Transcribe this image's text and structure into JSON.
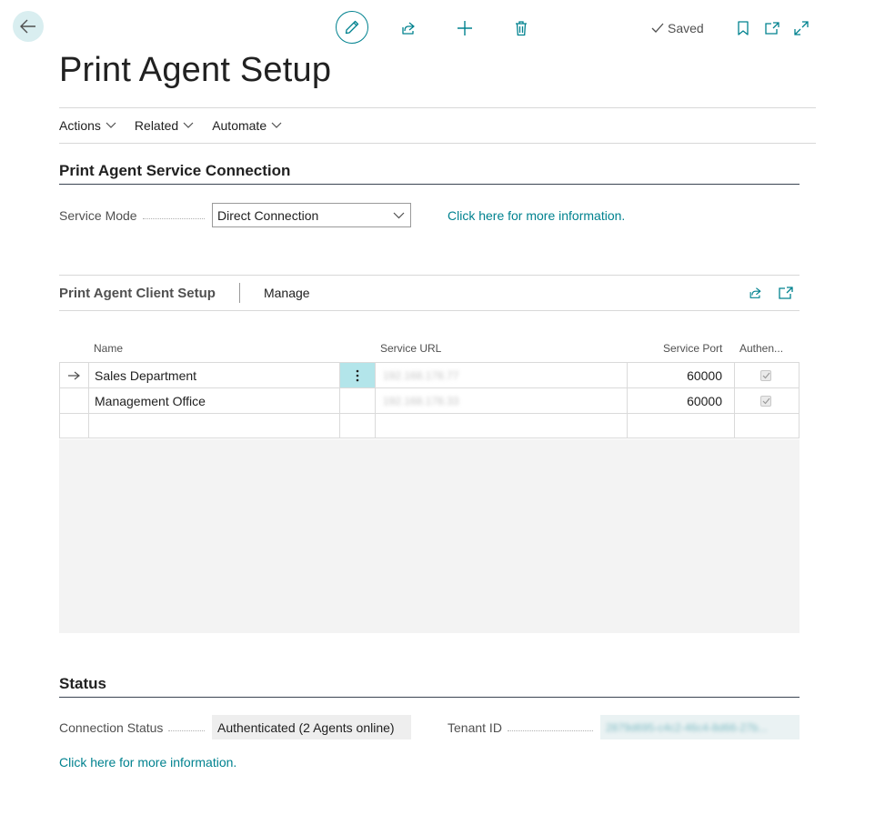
{
  "toolbar": {
    "saved_label": "Saved"
  },
  "page": {
    "title": "Print Agent Setup"
  },
  "menu": {
    "items": [
      {
        "label": "Actions"
      },
      {
        "label": "Related"
      },
      {
        "label": "Automate"
      }
    ]
  },
  "connection": {
    "title": "Print Agent Service Connection",
    "service_mode_label": "Service Mode",
    "service_mode_value": "Direct Connection",
    "info_link": "Click here for more information."
  },
  "client_setup": {
    "title": "Print Agent Client Setup",
    "manage_label": "Manage",
    "columns": {
      "name": "Name",
      "service_url": "Service URL",
      "service_port": "Service Port",
      "authenticated": "Authen..."
    },
    "rows": [
      {
        "name": "Sales Department",
        "service_url": "192.168.178.77",
        "service_port": "60000",
        "authenticated": true
      },
      {
        "name": "Management Office",
        "service_url": "192.168.178.33",
        "service_port": "60000",
        "authenticated": true
      }
    ]
  },
  "status": {
    "title": "Status",
    "connection_status_label": "Connection Status",
    "connection_status_value": "Authenticated (2 Agents online)",
    "tenant_id_label": "Tenant ID",
    "tenant_id_value": "2879d695-c4c2-46c4-8d66-27b...",
    "info_link": "Click here for more information."
  },
  "colors": {
    "accent": "#00828f",
    "back_button_bg": "#d9eef0",
    "selected_cell_bg": "#b3e5ea"
  }
}
